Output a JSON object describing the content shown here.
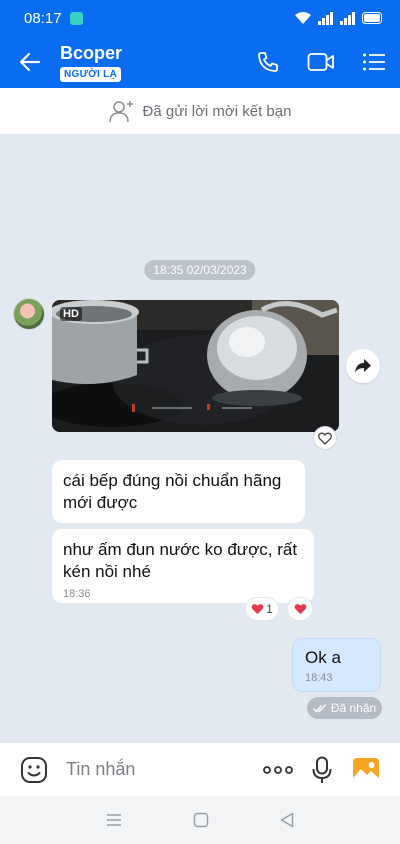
{
  "status_bar": {
    "time": "08:17"
  },
  "header": {
    "title": "Bcoper",
    "badge": "NGƯỜI LẠ"
  },
  "friend_request": {
    "text": "Đã gửi lời mời kết bạn"
  },
  "chat": {
    "date_divider": "18:35 02/03/2023",
    "photo": {
      "quality_badge": "HD"
    },
    "messages": [
      {
        "text": "cái bếp đúng nồi chuẩn hãng mới được"
      },
      {
        "text": "như ấm đun nước ko được, rất kén nồi nhé",
        "time": "18:36"
      }
    ],
    "reactions": [
      {
        "count": "1"
      }
    ],
    "outgoing": {
      "text": "Ok a",
      "time": "18:43",
      "status": "Đã nhận"
    }
  },
  "input": {
    "placeholder": "Tin nhắn"
  },
  "colors": {
    "primary": "#0a6cf0",
    "background": "#e2e9f1",
    "outgoing_bubble": "#d4e8ff",
    "heart": "#e53950"
  }
}
